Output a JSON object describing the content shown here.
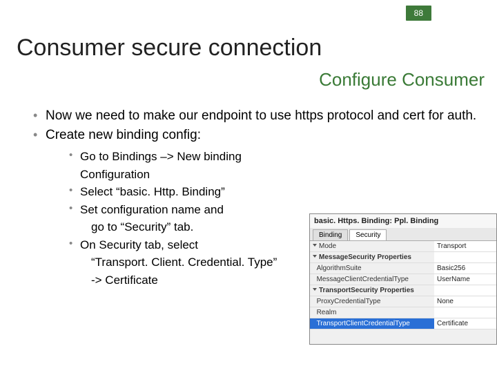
{
  "page_number": "88",
  "title": "Consumer secure connection",
  "subtitle": "Configure Consumer",
  "bullets": {
    "b1": "Now we need to make our endpoint to use https protocol and cert for auth.",
    "b2": "Create new binding config:",
    "s1": "Go to Bindings –> New binding Configuration",
    "s2": "Select “basic. Http. Binding”",
    "s3a": "Set configuration name and",
    "s3b": "go to “Security” tab.",
    "s4a": "On Security tab, select",
    "s4b": "“Transport. Client. Credential. Type”",
    "s4c": " -> Certificate"
  },
  "figure": {
    "header": "basic. Https. Binding: Ppl. Binding",
    "tabs": {
      "t1": "Binding",
      "t2": "Security"
    },
    "rows": [
      {
        "k": "Mode",
        "v": "Transport"
      },
      {
        "k": "MessageSecurity Properties",
        "v": ""
      },
      {
        "k": "AlgorithmSuite",
        "v": "Basic256"
      },
      {
        "k": "MessageClientCredentialType",
        "v": "UserName"
      },
      {
        "k": "TransportSecurity Properties",
        "v": ""
      },
      {
        "k": "ProxyCredentialType",
        "v": "None"
      },
      {
        "k": "Realm",
        "v": ""
      },
      {
        "k": "TransportClientCredentialType",
        "v": "Certificate"
      }
    ]
  }
}
